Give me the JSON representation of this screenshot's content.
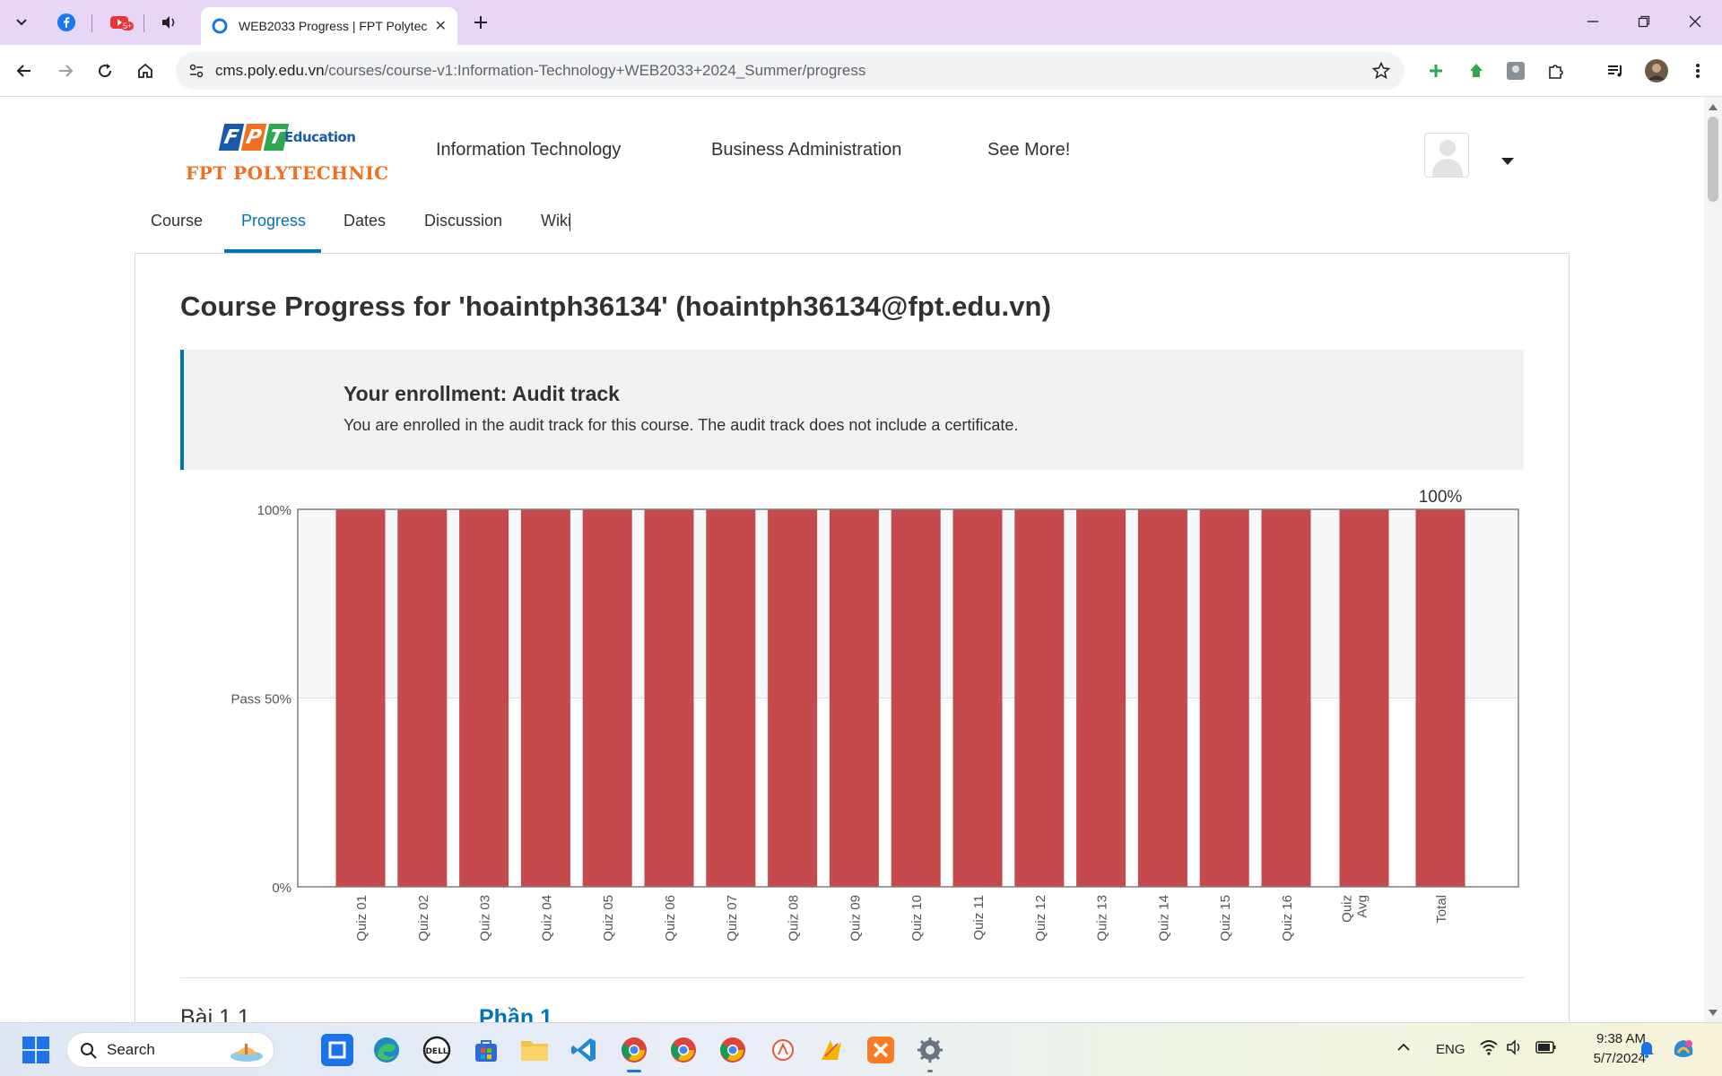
{
  "browser": {
    "tabs": [
      {
        "icon": "facebook-icon"
      },
      {
        "icon": "youtube-icon",
        "badge": "5+"
      },
      {
        "icon": "speaker-icon"
      },
      {
        "icon": "fpt-tab-icon",
        "title": "WEB2033 Progress | FPT Polytec",
        "active": true
      }
    ],
    "address": {
      "host": "cms.poly.edu.vn",
      "path": "/courses/course-v1:Information-Technology+WEB2033+2024_Summer/progress"
    }
  },
  "site": {
    "logo": {
      "letters": [
        "F",
        "P",
        "T"
      ],
      "education": "Education",
      "name": "FPT POLYTECHNIC"
    },
    "nav": [
      "Information Technology",
      "Business Administration",
      "See More!"
    ],
    "course_tabs": [
      "Course",
      "Progress",
      "Dates",
      "Discussion",
      "Wiki"
    ],
    "active_course_tab": "Progress"
  },
  "progress": {
    "heading": "Course Progress for 'hoaintph36134' (hoaintph36134@fpt.edu.vn)",
    "enrollment_title": "Your enrollment: Audit track",
    "enrollment_body": "You are enrolled in the audit track for this course. The audit track does not include a certificate."
  },
  "chart_data": {
    "type": "bar",
    "categories": [
      "Quiz 01",
      "Quiz 02",
      "Quiz 03",
      "Quiz 04",
      "Quiz 05",
      "Quiz 06",
      "Quiz 07",
      "Quiz 08",
      "Quiz 09",
      "Quiz 10",
      "Quiz 11",
      "Quiz 12",
      "Quiz 13",
      "Quiz 14",
      "Quiz 15",
      "Quiz 16",
      "Quiz Avg",
      "Total"
    ],
    "category_lines": [
      [
        "Quiz 01"
      ],
      [
        "Quiz 02"
      ],
      [
        "Quiz 03"
      ],
      [
        "Quiz 04"
      ],
      [
        "Quiz 05"
      ],
      [
        "Quiz 06"
      ],
      [
        "Quiz 07"
      ],
      [
        "Quiz 08"
      ],
      [
        "Quiz 09"
      ],
      [
        "Quiz 10"
      ],
      [
        "Quiz 11"
      ],
      [
        "Quiz 12"
      ],
      [
        "Quiz 13"
      ],
      [
        "Quiz 14"
      ],
      [
        "Quiz 15"
      ],
      [
        "Quiz 16"
      ],
      [
        "Quiz",
        "Avg"
      ],
      [
        "Total"
      ]
    ],
    "values": [
      100,
      100,
      100,
      100,
      100,
      100,
      100,
      100,
      100,
      100,
      100,
      100,
      100,
      100,
      100,
      100,
      100,
      100
    ],
    "y_ticks": [
      {
        "value": 100,
        "label": "100%"
      },
      {
        "value": 50,
        "label": "Pass 50%"
      },
      {
        "value": 0,
        "label": "0%"
      }
    ],
    "total_label": "100%",
    "ylim": [
      0,
      100
    ],
    "pass_threshold": 50,
    "bar_color": "#c44a4b",
    "pass_band_color": "#f7f8fa",
    "grid": false,
    "title": "",
    "xlabel": "",
    "ylabel": ""
  },
  "below_chart": {
    "left_heading": "Bài 1.1",
    "right_heading": "Phần 1",
    "right_color": "#0075b4"
  },
  "taskbar": {
    "search_placeholder": "Search",
    "apps": [
      "cortana-icon",
      "edge-icon",
      "dell-icon",
      "store-icon",
      "folder-icon",
      "vscode-icon",
      "chrome-icon",
      "chrome-icon",
      "chrome-icon",
      "app-icon",
      "app-icon",
      "xampp-icon",
      "settings-icon"
    ],
    "language": "ENG",
    "time": "9:38 AM",
    "date": "5/7/2024"
  },
  "colors": {
    "accent": "#0075b4",
    "tabstrip": "#e7d6f5",
    "brand_orange": "#f26f21",
    "logo_blue": "#1a5aa8",
    "logo_green": "#2fa84f"
  }
}
